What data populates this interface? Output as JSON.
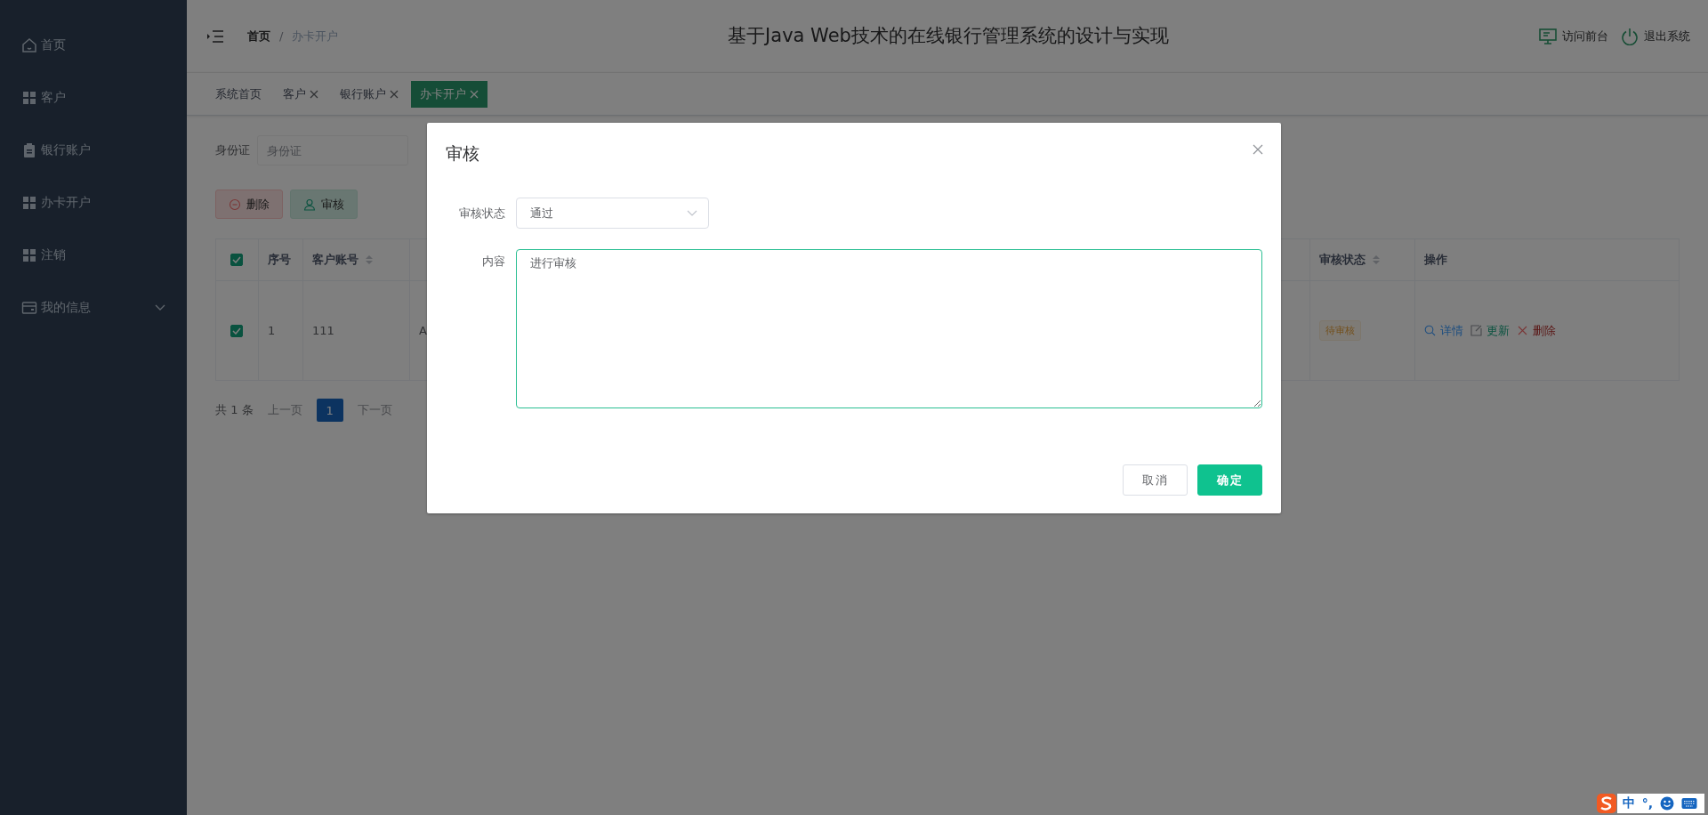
{
  "sidebar": {
    "items": [
      {
        "label": "首页",
        "kind": "home"
      },
      {
        "label": "客户",
        "kind": "grid"
      },
      {
        "label": "银行账户",
        "kind": "clipboard"
      },
      {
        "label": "办卡开户",
        "kind": "grid"
      },
      {
        "label": "注销",
        "kind": "grid"
      },
      {
        "label": "我的信息",
        "kind": "card",
        "expanded": false
      }
    ]
  },
  "header": {
    "breadcrumb": {
      "items": [
        "首页",
        "办卡开户"
      ],
      "separator": "/"
    },
    "title": "基于Java Web技术的在线银行管理系统的设计与实现",
    "links": [
      {
        "label": "访问前台",
        "kind": "monitor"
      },
      {
        "label": "退出系统",
        "kind": "power"
      }
    ]
  },
  "tabs": [
    {
      "label": "系统首页",
      "closable": false,
      "selected": false
    },
    {
      "label": "客户",
      "closable": true,
      "selected": false
    },
    {
      "label": "银行账户",
      "closable": true,
      "selected": false
    },
    {
      "label": "办卡开户",
      "closable": true,
      "selected": true
    }
  ],
  "search": {
    "label": "身份证",
    "placeholder": "身份证"
  },
  "toolbar": [
    {
      "label": "删除",
      "kind": "danger"
    },
    {
      "label": "审核",
      "kind": "audit"
    }
  ],
  "table": {
    "columns": [
      {
        "kind": "checkbox",
        "checked": true
      },
      {
        "kind": "text",
        "label": "序号",
        "sortable": false
      },
      {
        "kind": "text",
        "label": "客户账号",
        "sortable": true
      },
      {
        "kind": "text"
      },
      {
        "kind": "text",
        "label": "审核状态",
        "sortable": true
      },
      {
        "kind": "text",
        "label": "操作",
        "sortable": false
      }
    ],
    "rows": [
      {
        "cells": [
          {
            "kind": "checkbox",
            "checked": true
          },
          {
            "kind": "text",
            "text": "1"
          },
          {
            "kind": "text",
            "text": "111"
          },
          {
            "kind": "text",
            "text": "A"
          },
          {
            "kind": "tag",
            "text": "待审核"
          },
          {
            "kind": "actions",
            "actions": [
              {
                "label": "详情",
                "kind": "view"
              },
              {
                "label": "更新",
                "kind": "edit"
              },
              {
                "label": "删除",
                "kind": "delete"
              }
            ]
          }
        ]
      }
    ]
  },
  "pagination": {
    "total": "共 1 条",
    "prev": "上一页",
    "pages": [
      {
        "label": "1",
        "selected": true
      }
    ],
    "next": "下一页"
  },
  "dialog": {
    "title": "审核",
    "fields": [
      {
        "kind": "select",
        "label": "审核状态",
        "value": "通过"
      },
      {
        "kind": "textarea",
        "label": "内容",
        "value": "进行审核"
      }
    ],
    "buttons": [
      {
        "label": "取消",
        "kind": "default"
      },
      {
        "label": "确定",
        "kind": "primary"
      }
    ]
  },
  "ime": {
    "texts": [
      "中",
      "°,"
    ]
  }
}
